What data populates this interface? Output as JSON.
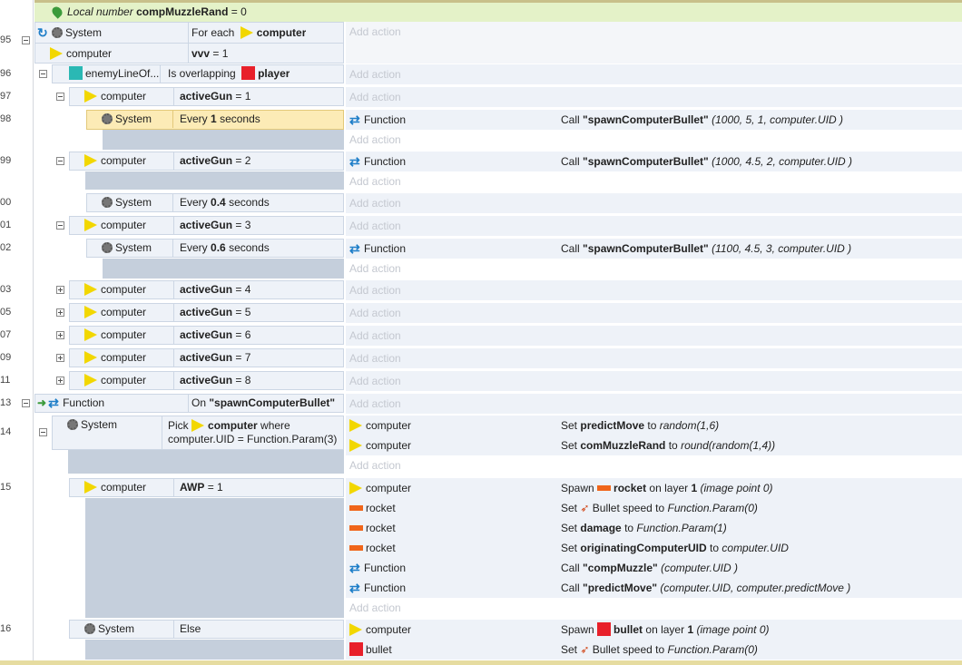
{
  "local_var": {
    "label": "Local number",
    "name": "compMuzzleRand",
    "value": "= 0"
  },
  "add_action": "Add action",
  "ev95": {
    "num": "95",
    "sys": "System",
    "foreach": "For each",
    "obj": "computer",
    "cond_obj": "computer",
    "cond_txt": "vvv",
    "cond_val": "= 1"
  },
  "ev96": {
    "num": "96",
    "obj": "enemyLineOf...",
    "txt": "Is overlapping",
    "target": "player"
  },
  "ev97": {
    "num": "97",
    "obj": "computer",
    "var": "activeGun",
    "val": "= 1"
  },
  "ev98": {
    "num": "98",
    "sys": "System",
    "pre": "Every",
    "n": "1",
    "post": "seconds",
    "a_obj": "Function",
    "call": "Call",
    "fn": "\"spawnComputerBullet\"",
    "args": "(1000, 5, 1, computer.UID )"
  },
  "ev99": {
    "num": "99",
    "obj": "computer",
    "var": "activeGun",
    "val": "= 2",
    "a_obj": "Function",
    "call": "Call",
    "fn": "\"spawnComputerBullet\"",
    "args": "(1000, 4.5, 2, computer.UID )"
  },
  "ev100": {
    "num": "00",
    "sys": "System",
    "pre": "Every",
    "n": "0.4",
    "post": "seconds"
  },
  "ev101": {
    "num": "01",
    "obj": "computer",
    "var": "activeGun",
    "val": "= 3"
  },
  "ev102": {
    "num": "02",
    "sys": "System",
    "pre": "Every",
    "n": "0.6",
    "post": "seconds",
    "a_obj": "Function",
    "call": "Call",
    "fn": "\"spawnComputerBullet\"",
    "args": "(1100, 4.5, 3, computer.UID )"
  },
  "collapsed": [
    {
      "num": "03",
      "obj": "computer",
      "var": "activeGun",
      "val": "= 4"
    },
    {
      "num": "05",
      "obj": "computer",
      "var": "activeGun",
      "val": "= 5"
    },
    {
      "num": "07",
      "obj": "computer",
      "var": "activeGun",
      "val": "= 6"
    },
    {
      "num": "09",
      "obj": "computer",
      "var": "activeGun",
      "val": "= 7"
    },
    {
      "num": "11",
      "obj": "computer",
      "var": "activeGun",
      "val": "= 8"
    }
  ],
  "ev113": {
    "num": "13",
    "obj": "Function",
    "on": "On",
    "fn": "\"spawnComputerBullet\""
  },
  "ev114": {
    "num": "14",
    "sys": "System",
    "pick": "Pick",
    "obj": "computer",
    "where": "where",
    "expr": "computer.UID = Function.Param(3)",
    "a1_obj": "computer",
    "a1_set": "Set",
    "a1_var": "predictMove",
    "a1_to": "to",
    "a1_val": "random(1,6)",
    "a2_obj": "computer",
    "a2_set": "Set",
    "a2_var": "comMuzzleRand",
    "a2_to": "to",
    "a2_val": "round(random(1,4))"
  },
  "ev115": {
    "num": "15",
    "obj": "computer",
    "var": "AWP",
    "val": "= 1",
    "actions": [
      {
        "obj": "computer",
        "p1": "Spawn",
        "b1": "rocket",
        "p2": "on layer",
        "b2": "1",
        "it": "(image point 0)"
      },
      {
        "obj": "rocket",
        "p1": "Set",
        "b1": "",
        "p2": "Bullet speed to",
        "b2": "",
        "it": "Function.Param(0)"
      },
      {
        "obj": "rocket",
        "p1": "Set",
        "b1": "damage",
        "p2": "to",
        "b2": "",
        "it": "Function.Param(1)"
      },
      {
        "obj": "rocket",
        "p1": "Set",
        "b1": "originatingComputerUID",
        "p2": "to",
        "b2": "",
        "it": "computer.UID"
      },
      {
        "obj": "Function",
        "p1": "Call",
        "b1": "\"compMuzzle\"",
        "p2": "",
        "b2": "",
        "it": "(computer.UID )"
      },
      {
        "obj": "Function",
        "p1": "Call",
        "b1": "\"predictMove\"",
        "p2": "",
        "b2": "",
        "it": "(computer.UID, computer.predictMove )"
      }
    ]
  },
  "ev116": {
    "num": "16",
    "sys": "System",
    "else": "Else",
    "a1_obj": "computer",
    "a1_p1": "Spawn",
    "a1_b1": "bullet",
    "a1_p2": "on layer",
    "a1_b2": "1",
    "a1_it": "(image point 0)",
    "a2_obj": "bullet",
    "a2_p1": "Set",
    "a2_p2": "Bullet speed to",
    "a2_it": "Function.Param(0)"
  },
  "colors": {
    "player": "#e8202a",
    "bullet": "#e8202a",
    "rocket": "#f0651a",
    "enemyLine": "#2ab8b4",
    "accent": "#1e7ec8"
  }
}
